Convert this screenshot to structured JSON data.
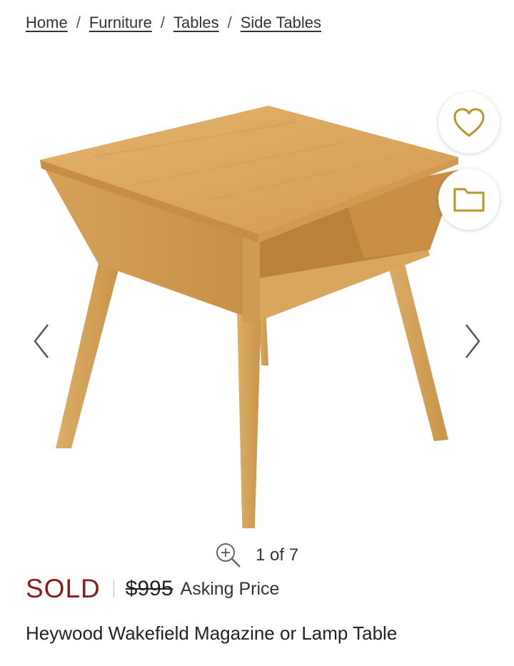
{
  "breadcrumb": {
    "home": "Home",
    "furniture": "Furniture",
    "tables": "Tables",
    "side_tables": "Side Tables",
    "separator": "/"
  },
  "gallery": {
    "current": "1",
    "of": "of",
    "total": "7",
    "counter_text": "1 of 7"
  },
  "listing": {
    "status": "SOLD",
    "price": "$995",
    "price_label": "Asking Price",
    "title": "Heywood Wakefield Magazine or Lamp Table"
  },
  "icons": {
    "favorite": "heart-icon",
    "save": "folder-icon",
    "prev": "chevron-left-icon",
    "next": "chevron-right-icon",
    "zoom": "zoom-in-icon"
  },
  "colors": {
    "sold": "#8b1a1a",
    "accent_gold": "#b8962e",
    "wood": "#d9a65a"
  }
}
